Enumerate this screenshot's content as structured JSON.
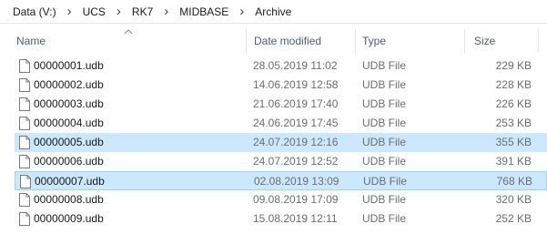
{
  "breadcrumb": [
    "Data (V:)",
    "UCS",
    "RK7",
    "MIDBASE",
    "Archive"
  ],
  "columns": {
    "name": "Name",
    "date": "Date modified",
    "type": "Type",
    "size": "Size"
  },
  "sort": {
    "column": "name",
    "direction": "ascending",
    "icon": "chevron-up-icon"
  },
  "files": [
    {
      "name": "00000001.udb",
      "date": "28.05.2019 11:02",
      "type": "UDB File",
      "size": "229 KB",
      "state": ""
    },
    {
      "name": "00000002.udb",
      "date": "14.06.2019 12:58",
      "type": "UDB File",
      "size": "228 KB",
      "state": ""
    },
    {
      "name": "00000003.udb",
      "date": "21.06.2019 17:40",
      "type": "UDB File",
      "size": "226 KB",
      "state": ""
    },
    {
      "name": "00000004.udb",
      "date": "24.06.2019 17:45",
      "type": "UDB File",
      "size": "253 KB",
      "state": ""
    },
    {
      "name": "00000005.udb",
      "date": "24.07.2019 12:16",
      "type": "UDB File",
      "size": "355 KB",
      "state": "selected"
    },
    {
      "name": "00000006.udb",
      "date": "24.07.2019 12:52",
      "type": "UDB File",
      "size": "391 KB",
      "state": ""
    },
    {
      "name": "00000007.udb",
      "date": "02.08.2019 13:09",
      "type": "UDB File",
      "size": "768 KB",
      "state": "focused"
    },
    {
      "name": "00000008.udb",
      "date": "09.08.2019 17:09",
      "type": "UDB File",
      "size": "320 KB",
      "state": ""
    },
    {
      "name": "00000009.udb",
      "date": "15.08.2019 12:11",
      "type": "UDB File",
      "size": "252 KB",
      "state": ""
    }
  ],
  "colors": {
    "selected_bg": "#cce8ff",
    "focus_border": "#99d1ff",
    "header_text": "#4c607a"
  }
}
